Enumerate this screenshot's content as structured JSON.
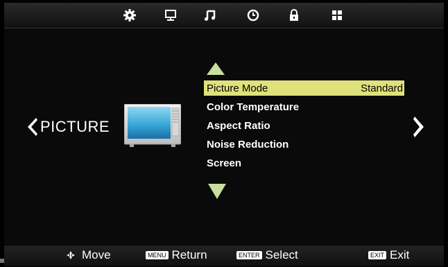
{
  "top_tabs": [
    {
      "name": "gear-icon",
      "active": true
    },
    {
      "name": "monitor-icon",
      "active": false
    },
    {
      "name": "music-note-icon",
      "active": false
    },
    {
      "name": "clock-icon",
      "active": false
    },
    {
      "name": "lock-icon",
      "active": false
    },
    {
      "name": "grid-icon",
      "active": false
    }
  ],
  "page": {
    "title": "PICTURE"
  },
  "menu": {
    "items": [
      {
        "label": "Picture Mode",
        "value": "Standard",
        "selected": true
      },
      {
        "label": "Color Temperature",
        "value": "",
        "selected": false
      },
      {
        "label": "Aspect Ratio",
        "value": "",
        "selected": false
      },
      {
        "label": "Noise Reduction",
        "value": "",
        "selected": false
      },
      {
        "label": "Screen",
        "value": "",
        "selected": false
      }
    ]
  },
  "hints": {
    "move_label": "Move",
    "menu_key": "MENU",
    "return_label": "Return",
    "enter_key": "ENTER",
    "select_label": "Select",
    "exit_key": "EXIT",
    "exit_label": "Exit"
  },
  "colors": {
    "highlight": "#dfe17a",
    "arrow": "#c8dfa0",
    "background": "#000000",
    "text": "#ffffff"
  }
}
